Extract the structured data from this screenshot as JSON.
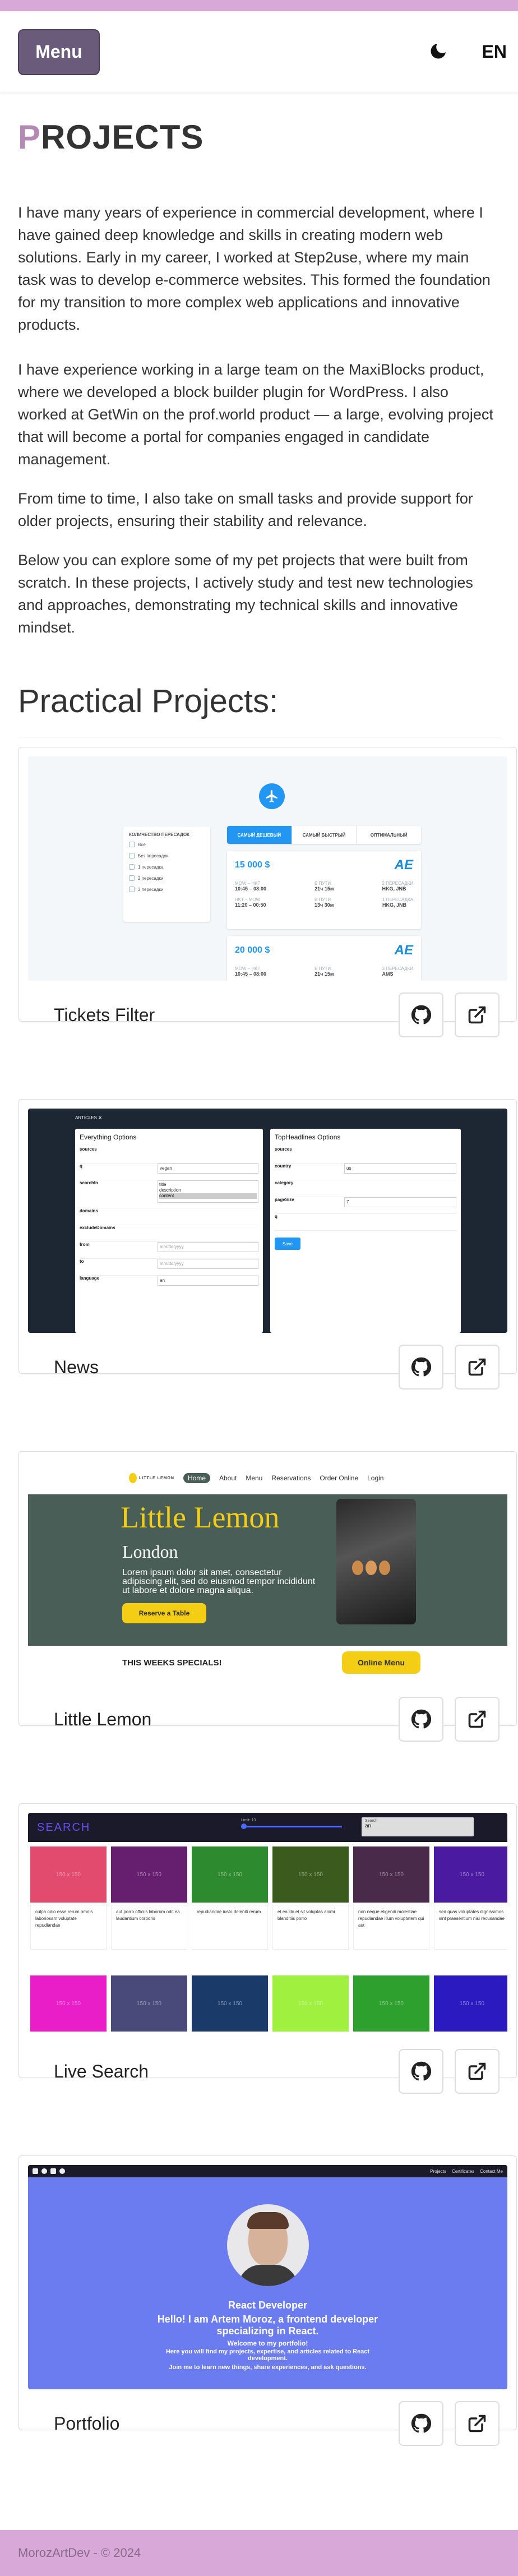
{
  "header": {
    "menu_label": "Menu",
    "lang_label": "EN"
  },
  "page": {
    "title_first": "P",
    "title_rest": "ROJECTS",
    "paragraphs": [
      "I have many years of experience in commercial development, where I have gained deep knowledge and skills in creating modern web solutions. Early in my career, I worked at Step2use, where my main task was to develop e-commerce websites. This formed the foundation for my transition to more complex web applications and innovative products.",
      "I have experience working in a large team on the MaxiBlocks product, where we developed a block builder plugin for WordPress. I also worked at GetWin on the prof.world product — a large, evolving project that will become a portal for companies engaged in candidate management.",
      "From time to time, I also take on small tasks and provide support for older projects, ensuring their stability and relevance.",
      "Below you can explore some of my pet projects that were built from scratch. In these projects, I actively study and test new technologies and approaches, demonstrating my technical skills and innovative mindset."
    ],
    "section_title": "Practical Projects:"
  },
  "projects": [
    {
      "title": "Tickets Filter"
    },
    {
      "title": "News"
    },
    {
      "title": "Little Lemon"
    },
    {
      "title": "Live Search"
    },
    {
      "title": "Portfolio"
    }
  ],
  "mock_tickets": {
    "filter_title": "КОЛИЧЕСТВО ПЕРЕСАДОК",
    "filter_options": [
      "Все",
      "Без пересадок",
      "1 пересадка",
      "2 пересадки",
      "3 пересадки"
    ],
    "tabs": [
      "САМЫЙ ДЕШЕВЫЙ",
      "САМЫЙ БЫСТРЫЙ",
      "ОПТИМАЛЬНЫЙ"
    ],
    "price_1": "15 000 $",
    "price_2": "20 000 $",
    "airline": "AE",
    "route_1": "MOW – HKT",
    "time_1": "10:45 – 08:00",
    "route_2": "HKT – MOW",
    "time_2": "11:20 – 00:50",
    "route_3": "MOW – HKT",
    "time_3": "10:45 – 08:00",
    "col_travel": "В ПУТИ",
    "dur_1": "21ч 15м",
    "dur_2": "13ч 30м",
    "dur_3": "21ч 15м",
    "col_stops_2": "2 ПЕРЕСАДКИ",
    "col_stops_1": "1 ПЕРЕСАДКА",
    "col_stops_3": "3 ПЕРЕСАДКИ",
    "stops_1": "HKG, JNB",
    "stops_2": "HKG",
    "stops_3": "AMS"
  },
  "mock_news": {
    "nav_label": "ARTICLES",
    "left_title": "Everything Options",
    "right_title": "TopHeadlines Options",
    "left_fields": [
      "sources",
      "q",
      "searchIn",
      "domains",
      "excludeDomains",
      "from",
      "to",
      "language"
    ],
    "right_fields": [
      "sources",
      "country",
      "category",
      "pageSize",
      "q"
    ],
    "q_value": "vegan",
    "searchin_options": [
      "title",
      "description",
      "content"
    ],
    "from_placeholder": "mm/dd/yyyy",
    "to_placeholder": "mm/dd/yyyy",
    "language_value": "en",
    "country_value": "us",
    "pagesize_value": "7",
    "save_label": "Save"
  },
  "mock_lemon": {
    "logo": "LITTLE LEMON",
    "nav": [
      "Home",
      "About",
      "Menu",
      "Reservations",
      "Order Online",
      "Login"
    ],
    "hero_title": "Little Lemon",
    "hero_subtitle": "London",
    "hero_text": "Lorem ipsum dolor sit amet, consectetur adipiscing elit, sed do eiusmod tempor incididunt ut labore et dolore magna aliqua.",
    "reserve_label": "Reserve a Table",
    "specials": "THIS WEEKS SPECIALS!",
    "online_menu": "Online Menu"
  },
  "mock_search": {
    "logo": "SEARCH",
    "slider_label": "Limit: 13",
    "input_label": "Search",
    "input_value": "an",
    "tile_label": "150 x 150",
    "texts": [
      "culpa odio esse rerum omnis laboriosam voluptate repudiandae",
      "aut porro officiis laborum odit ea laudantium corporis",
      "repudiandae iusto deleniti rerum",
      "et ea illo et sit voluptas animi blanditiis porro",
      "non neque eligendi molestiae repudiandae illum voluptatem qui aut",
      "sed quas voluptates dignissimos sint praesentium nisi recusandae"
    ],
    "row1_colors": [
      "#e24a6e",
      "#661e6e",
      "#2e8a2e",
      "#3a5a1e",
      "#4a2a4a",
      "#4a1aa0"
    ],
    "row2_colors": [
      "#e91ec8",
      "#4a4a7a",
      "#1a3a6a",
      "#a0f040",
      "#2ea02e",
      "#2a1ac0"
    ]
  },
  "mock_portfolio": {
    "nav_links": [
      "Projects",
      "Certificates",
      "Contact Me"
    ],
    "role": "React Developer",
    "hello": "Hello! I am Artem Moroz, a frontend developer specializing in React.",
    "welcome": "Welcome to my portfolio!",
    "line1": "Here you will find my projects, expertise, and articles related to React development.",
    "line2": "Join me to learn new things, share experiences, and ask questions."
  },
  "footer": {
    "text": "MorozArtDev - © 2024"
  }
}
